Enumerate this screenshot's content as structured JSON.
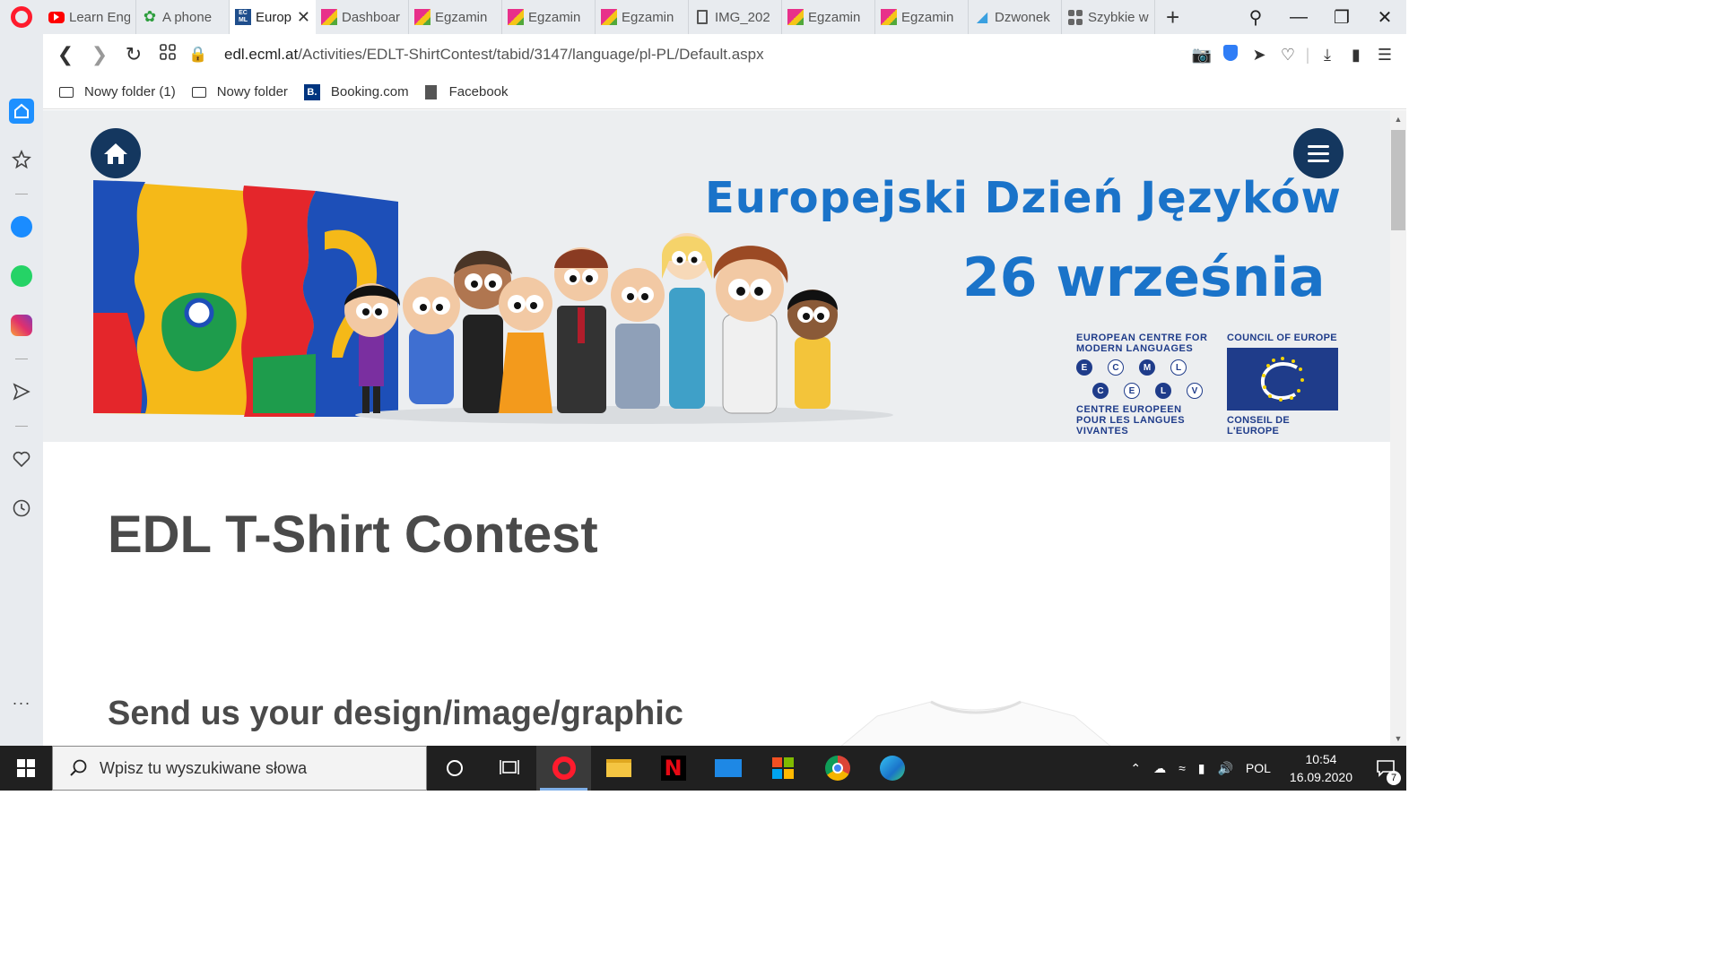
{
  "browser": {
    "tabs": [
      {
        "label": "Learn Eng",
        "icon": "youtube-icon"
      },
      {
        "label": "A phone",
        "icon": "clover-icon"
      },
      {
        "label": "Europ",
        "icon": "ecml-icon",
        "active": true
      },
      {
        "label": "Dashboar",
        "icon": "moodle-icon"
      },
      {
        "label": "Egzamin",
        "icon": "moodle-icon"
      },
      {
        "label": "Egzamin",
        "icon": "moodle-icon"
      },
      {
        "label": "Egzamin",
        "icon": "moodle-icon"
      },
      {
        "label": "IMG_202",
        "icon": "document-icon"
      },
      {
        "label": "Egzamin",
        "icon": "moodle-icon"
      },
      {
        "label": "Egzamin",
        "icon": "moodle-icon"
      },
      {
        "label": "Dzwonek",
        "icon": "bell-icon"
      },
      {
        "label": "Szybkie w",
        "icon": "speed-dial-icon"
      }
    ],
    "url_host": "edl.ecml.at",
    "url_path": "/Activities/EDLT-ShirtContest/tabid/3147/language/pl-PL/Default.aspx",
    "bookmarks": [
      {
        "label": "Nowy folder (1)",
        "icon": "folder-icon"
      },
      {
        "label": "Nowy folder",
        "icon": "folder-icon"
      },
      {
        "label": "Booking.com",
        "icon": "booking-icon"
      },
      {
        "label": "Facebook",
        "icon": "document-icon"
      }
    ]
  },
  "banner": {
    "title": "Europejski Dzień Języków",
    "date": "26 września",
    "ecml_top": "EUROPEAN CENTRE FOR MODERN LANGUAGES",
    "ecml_bottom": "CENTRE EUROPEEN POUR LES LANGUES VIVANTES",
    "ecml_letters": [
      "E",
      "C",
      "M",
      "L",
      "C",
      "E",
      "L",
      "V"
    ],
    "coe_top": "COUNCIL OF EUROPE",
    "coe_bottom": "CONSEIL DE L'EUROPE"
  },
  "content": {
    "title": "EDL T-Shirt Contest",
    "subtitle": "Send us your design/image/graphic"
  },
  "taskbar": {
    "search_placeholder": "Wpisz tu wyszukiwane słowa",
    "language": "POL",
    "time": "10:54",
    "date": "16.09.2020",
    "notifications": "7"
  },
  "colors": {
    "accent_blue": "#1a73c9",
    "navy": "#14375f",
    "opera_red": "#ff1b2d"
  }
}
